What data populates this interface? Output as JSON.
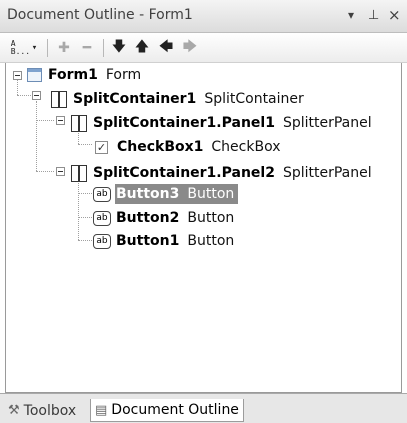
{
  "window": {
    "title": "Document Outline - Form1",
    "dropdown_glyph": "▾",
    "pin_glyph": "⊥",
    "close_glyph": "×"
  },
  "toolbar": {
    "view_label": "AB...",
    "items": [
      {
        "icon": "view-mode-icon"
      },
      {
        "icon": "expand-all-icon"
      },
      {
        "icon": "collapse-all-icon"
      },
      {
        "icon": "move-down-icon"
      },
      {
        "icon": "move-up-icon"
      },
      {
        "icon": "move-out-icon"
      },
      {
        "icon": "move-in-icon"
      }
    ]
  },
  "tree": [
    {
      "name": "Form1",
      "type": "Form",
      "icon": "form-icon"
    },
    {
      "name": "SplitContainer1",
      "type": "SplitContainer",
      "icon": "split-container-icon"
    },
    {
      "name": "SplitContainer1.Panel1",
      "type": "SplitterPanel",
      "icon": "splitter-panel-icon"
    },
    {
      "name": "CheckBox1",
      "type": "CheckBox",
      "icon": "checkbox-icon"
    },
    {
      "name": "SplitContainer1.Panel2",
      "type": "SplitterPanel",
      "icon": "splitter-panel-icon"
    },
    {
      "name": "Button3",
      "type": "Button",
      "icon": "button-icon",
      "selected": true
    },
    {
      "name": "Button2",
      "type": "Button",
      "icon": "button-icon"
    },
    {
      "name": "Button1",
      "type": "Button",
      "icon": "button-icon"
    }
  ],
  "button_icon_text": "ab",
  "check_glyph": "✓",
  "tabs": [
    {
      "label": "Toolbox",
      "active": false
    },
    {
      "label": "Document Outline",
      "active": true
    }
  ]
}
